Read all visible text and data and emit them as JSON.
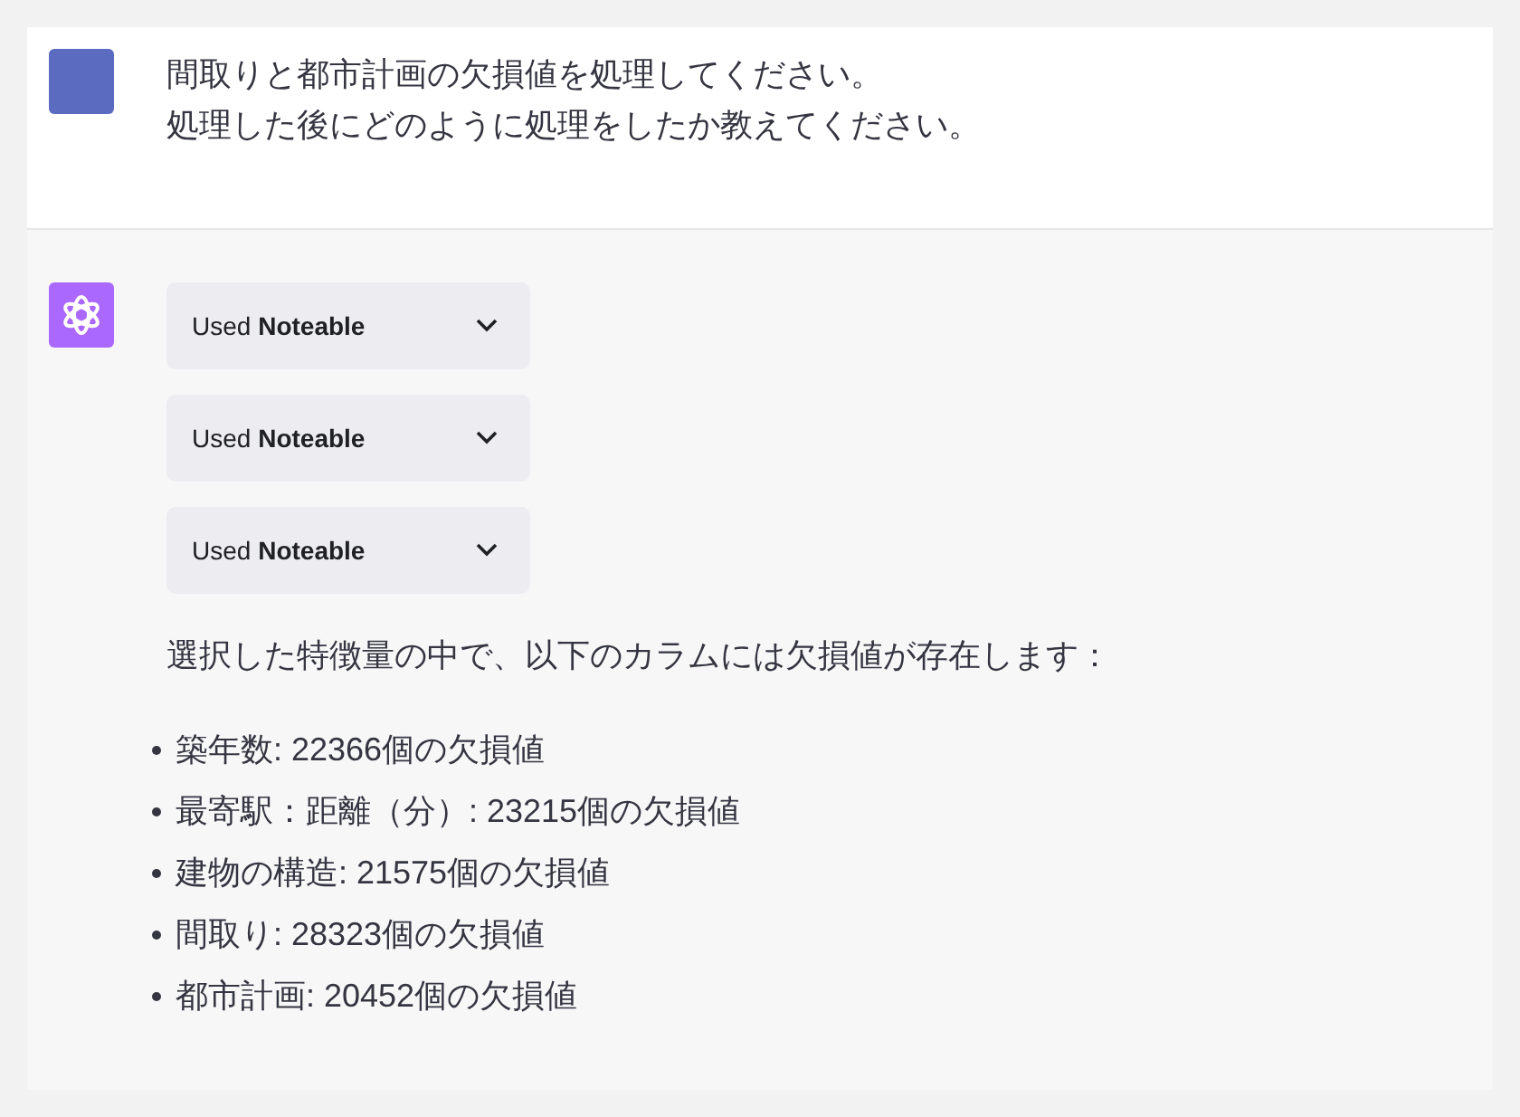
{
  "user_message": {
    "lines": [
      "間取りと都市計画の欠損値を処理してください。",
      "処理した後にどのように処理をしたか教えてください。"
    ]
  },
  "assistant_message": {
    "tool_calls": [
      {
        "label": "Used **Noteable**",
        "expanded": false
      },
      {
        "label": "Used **Noteable**",
        "expanded": false
      },
      {
        "label": "Used **Noteable**",
        "expanded": false
      }
    ],
    "paragraph": "選択した特徴量の中で、以下のカラムには欠損値が存在します：",
    "bullets": [
      "築年数: 22366個の欠損値",
      "最寄駅：距離（分）: 23215個の欠損値",
      "建物の構造: 21575個の欠損値",
      "間取り: 28323個の欠損値",
      "都市計画: 20452個の欠損値"
    ]
  }
}
